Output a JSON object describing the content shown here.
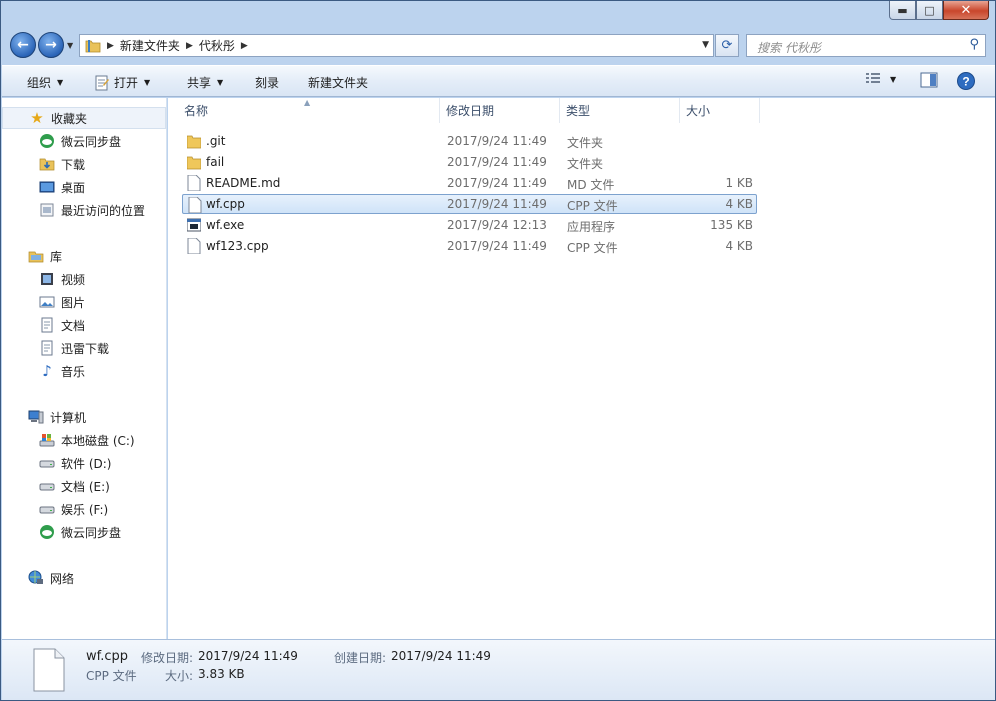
{
  "window": {
    "caption_buttons": {
      "minimize": "▬",
      "maximize": "□",
      "close": "✕"
    }
  },
  "nav": {
    "back_icon": "back-arrow-icon",
    "forward_icon": "forward-arrow-icon",
    "breadcrumbs": [
      "新建文件夹",
      "代秋彤"
    ],
    "search_placeholder": "搜索 代秋彤"
  },
  "toolbar": {
    "organize": "组织",
    "open": "打开",
    "share": "共享",
    "burn": "刻录",
    "new_folder": "新建文件夹"
  },
  "sidebar": {
    "favorites_label": "收藏夹",
    "favorites": [
      "微云同步盘",
      "下载",
      "桌面",
      "最近访问的位置"
    ],
    "libraries_label": "库",
    "libraries": [
      "视频",
      "图片",
      "文档",
      "迅雷下载",
      "音乐"
    ],
    "computer_label": "计算机",
    "drives": [
      "本地磁盘 (C:)",
      "软件 (D:)",
      "文档 (E:)",
      "娱乐 (F:)",
      "微云同步盘"
    ],
    "network_label": "网络"
  },
  "columns": {
    "name": "名称",
    "modified": "修改日期",
    "type": "类型",
    "size": "大小"
  },
  "files": [
    {
      "name": ".git",
      "modified": "2017/9/24 11:49",
      "type": "文件夹",
      "size": "",
      "icon": "folder-icon"
    },
    {
      "name": "fail",
      "modified": "2017/9/24 11:49",
      "type": "文件夹",
      "size": "",
      "icon": "folder-icon"
    },
    {
      "name": "README.md",
      "modified": "2017/9/24 11:49",
      "type": "MD 文件",
      "size": "1 KB",
      "icon": "document-icon"
    },
    {
      "name": "wf.cpp",
      "modified": "2017/9/24 11:49",
      "type": "CPP 文件",
      "size": "4 KB",
      "icon": "document-icon"
    },
    {
      "name": "wf.exe",
      "modified": "2017/9/24 12:13",
      "type": "应用程序",
      "size": "135 KB",
      "icon": "exe-icon"
    },
    {
      "name": "wf123.cpp",
      "modified": "2017/9/24 11:49",
      "type": "CPP 文件",
      "size": "4 KB",
      "icon": "document-icon"
    }
  ],
  "details": {
    "name": "wf.cpp",
    "type": "CPP 文件",
    "modified_label": "修改日期:",
    "modified": "2017/9/24 11:49",
    "created_label": "创建日期:",
    "created": "2017/9/24 11:49",
    "size_label": "大小:",
    "size": "3.83 KB"
  }
}
